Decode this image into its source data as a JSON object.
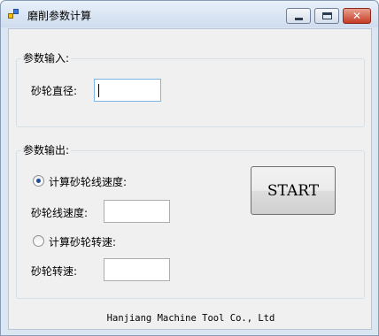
{
  "window": {
    "title": "磨削参数计算",
    "minimize_icon": "minimize-icon",
    "maximize_icon": "maximize-icon",
    "close_icon": "close-icon"
  },
  "input_group": {
    "title": "参数输入:",
    "diameter_label": "砂轮直径:",
    "diameter_value": ""
  },
  "output_group": {
    "title": "参数输出:",
    "option_linear": {
      "label": "计算砂轮线速度:",
      "selected": true
    },
    "linear_speed_label": "砂轮线速度:",
    "linear_speed_value": "",
    "option_rotation": {
      "label": "计算砂轮转速:",
      "selected": false
    },
    "rotation_speed_label": "砂轮转速:",
    "rotation_speed_value": ""
  },
  "start_button": {
    "label": "START"
  },
  "footer": {
    "text": "Hanjiang Machine Tool Co., Ltd"
  },
  "colors": {
    "title_bar": "#dbe6f3",
    "client_bg": "#f0f0f0",
    "close_button": "#c63b25",
    "radio_selected": "#1b4f9c"
  }
}
